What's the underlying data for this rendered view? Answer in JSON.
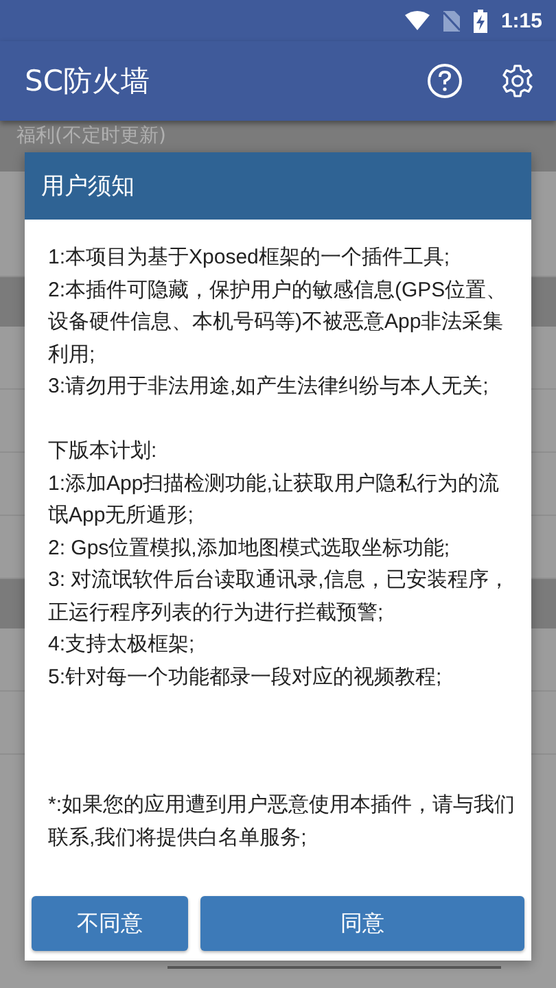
{
  "status_bar": {
    "time": "1:15"
  },
  "app_bar": {
    "title": "SC防火墙"
  },
  "background": {
    "section_title": "福利(不定时更新)"
  },
  "dialog": {
    "title": "用户须知",
    "notices": [
      "1:本项目为基于Xposed框架的一个插件工具;",
      "2:本插件可隐藏，保护用户的敏感信息(GPS位置、设备硬件信息、本机号码等)不被恶意App非法采集利用;",
      "3:请勿用于非法用途,如产生法律纠纷与本人无关;"
    ],
    "plan_heading": "下版本计划:",
    "plans": [
      "1:添加App扫描检测功能,让获取用户隐私行为的流氓App无所遁形;",
      "2: Gps位置模拟,添加地图模式选取坐标功能;",
      "3: 对流氓软件后台读取通讯录,信息，已安装程序，正运行程序列表的行为进行拦截预警;",
      "4:支持太极框架;",
      "5:针对每一个功能都录一段对应的视频教程;"
    ],
    "footnote": "*:如果您的应用遭到用户恶意使用本插件，请与我们联系,我们将提供白名单服务;",
    "buttons": [
      "不同意",
      "同意"
    ]
  }
}
